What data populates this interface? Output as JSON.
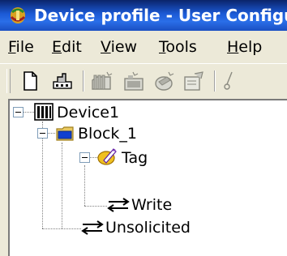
{
  "window": {
    "title": "Device profile - User Configuration"
  },
  "menu": [
    {
      "underline": "F",
      "rest": "ile"
    },
    {
      "underline": "E",
      "rest": "dit"
    },
    {
      "underline": "V",
      "rest": "iew"
    },
    {
      "underline": "T",
      "rest": "ools"
    },
    {
      "underline": "H",
      "rest": "elp"
    }
  ],
  "toolbar": {
    "buttons": [
      "new-file-icon",
      "connect-icon",
      "add-block-icon",
      "add-tag-icon",
      "add-write-icon",
      "properties-icon",
      "cut-icon"
    ]
  },
  "tree": {
    "device": "Device1",
    "block": "Block_1",
    "tag": "Tag",
    "write": "Write",
    "unsolicited": "Unsolicited"
  },
  "colors": {
    "titlebar": "#1c5ad6",
    "window_bg": "#ece9d8",
    "tree_bg": "#ffffff"
  }
}
